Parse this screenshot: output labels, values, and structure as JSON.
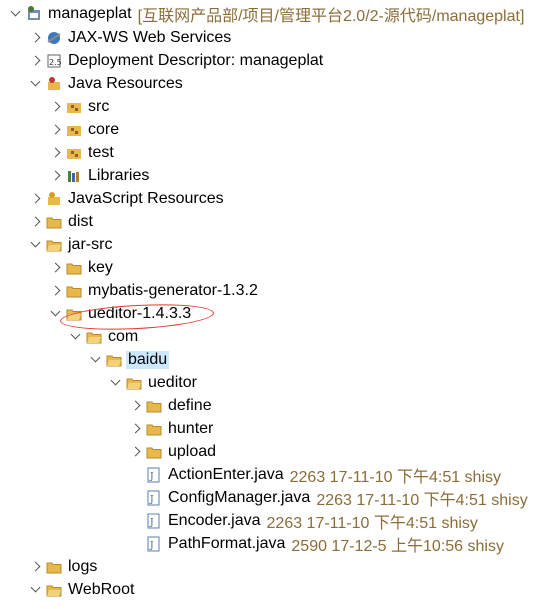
{
  "project": {
    "name": "manageplat",
    "path": "[互联网产品部/项目/管理平台2.0/2-源代码/manageplat]"
  },
  "nodes": {
    "jaxws": "JAX-WS Web Services",
    "deploy": "Deployment Descriptor: manageplat",
    "javares": "Java Resources",
    "src": "src",
    "core": "core",
    "test": "test",
    "libraries": "Libraries",
    "jsres": "JavaScript Resources",
    "dist": "dist",
    "jarsrc": "jar-src",
    "key": "key",
    "mybatis": "mybatis-generator-1.3.2",
    "ueditor143": "ueditor-1.4.3.3",
    "com": "com",
    "baidu": "baidu",
    "ueditor": "ueditor",
    "define": "define",
    "hunter": "hunter",
    "upload": "upload",
    "logs": "logs",
    "webroot": "WebRoot"
  },
  "files": [
    {
      "name": "ActionEnter.java",
      "meta": "2263  17-11-10 下午4:51  shisy"
    },
    {
      "name": "ConfigManager.java",
      "meta": "2263  17-11-10 下午4:51  shisy"
    },
    {
      "name": "Encoder.java",
      "meta": "2263  17-11-10 下午4:51  shisy"
    },
    {
      "name": "PathFormat.java",
      "meta": "2590  17-12-5 上午10:56  shisy"
    }
  ],
  "colors": {
    "folder": "#e8b84a",
    "selection": "#cce8ff",
    "annotation": "#e0382f",
    "decoration": "#8b6d3a"
  }
}
